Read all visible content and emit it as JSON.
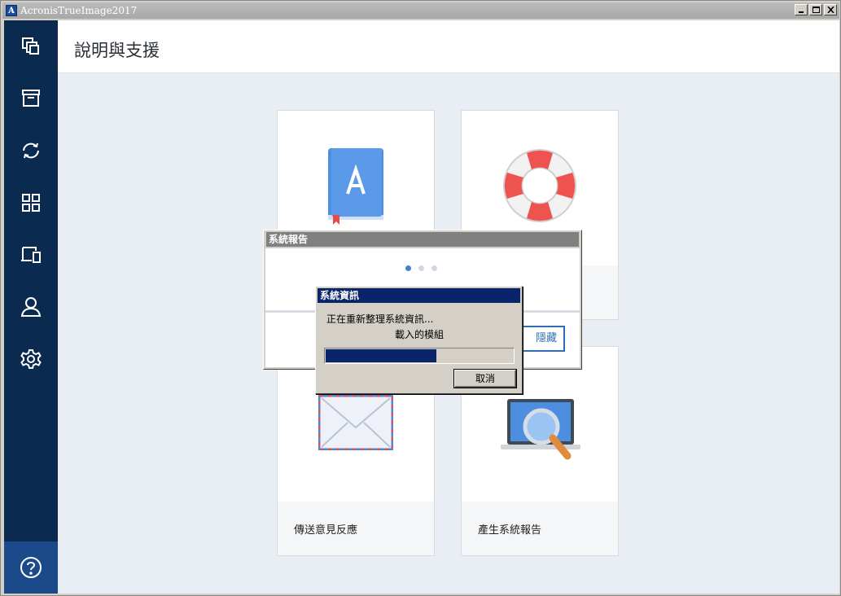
{
  "window": {
    "title": "AcronisTrueImage2017",
    "app_icon_letter": "A"
  },
  "sidebar": {
    "items": [
      {
        "icon": "backup-icon"
      },
      {
        "icon": "archive-icon"
      },
      {
        "icon": "sync-icon"
      },
      {
        "icon": "dashboard-icon"
      },
      {
        "icon": "devices-icon"
      },
      {
        "icon": "account-icon"
      },
      {
        "icon": "settings-icon"
      }
    ],
    "help_icon": "help-icon",
    "accent": "#0b2a4f",
    "active_bg": "#1b4a8a"
  },
  "header": {
    "title": "說明與支援"
  },
  "cards": [
    {
      "icon": "user-guide-book-icon",
      "label": ""
    },
    {
      "icon": "life-ring-icon",
      "label": ""
    },
    {
      "icon": "envelope-icon",
      "label": "傳送意見反應"
    },
    {
      "icon": "laptop-magnifier-icon",
      "label": "產生系統報告"
    }
  ],
  "system_report_dialog": {
    "title": "系統報告",
    "hide_button_label": "隱藏",
    "loading_dots": 3
  },
  "system_info_dialog": {
    "title": "系統資訊",
    "message": "正在重新整理系統資訊...",
    "sub_message": "載入的模組",
    "progress": 0.59,
    "cancel_label": "取消"
  }
}
